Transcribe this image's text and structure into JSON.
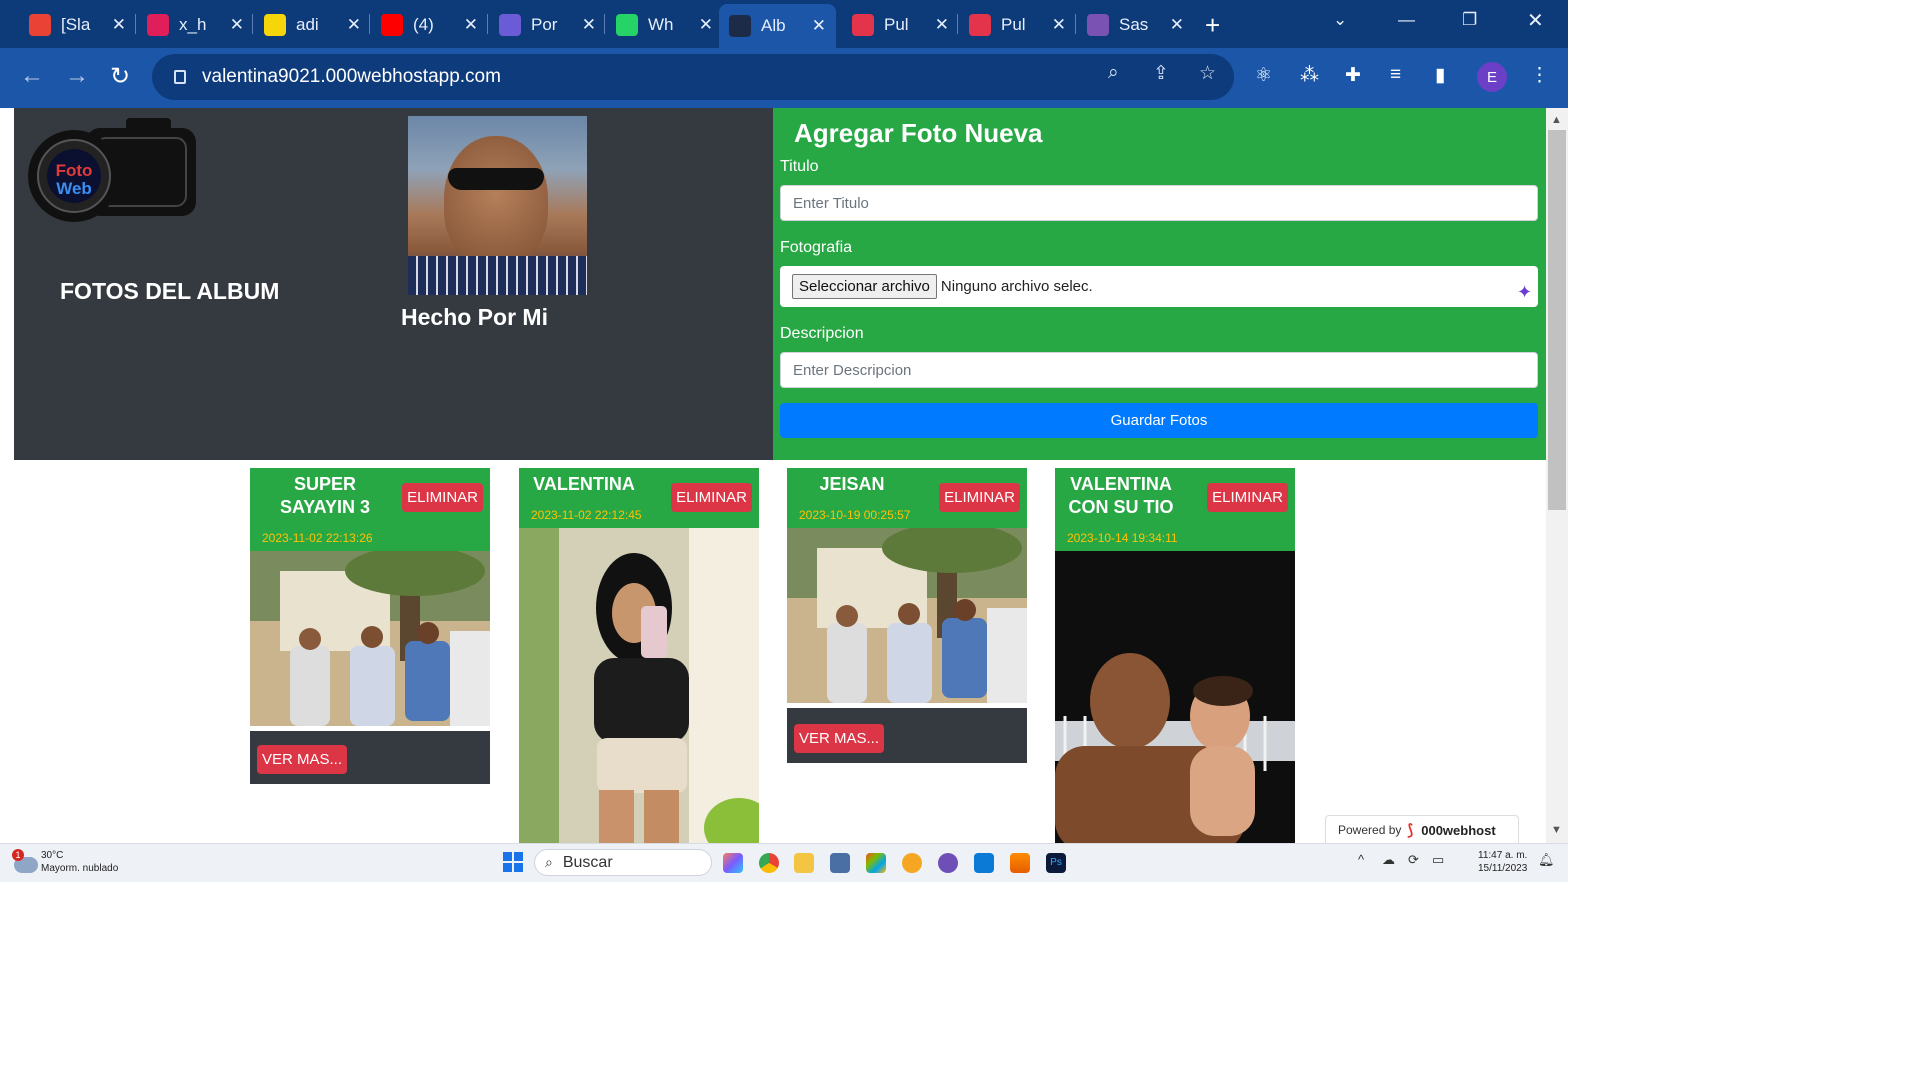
{
  "browser": {
    "tabs": [
      {
        "title": "[Sla",
        "icon": "gmail-icon",
        "color": "#ea4335"
      },
      {
        "title": "x_h",
        "icon": "slack-icon",
        "color": "#e01e5a"
      },
      {
        "title": "adi",
        "icon": "app-grid-icon",
        "color": "#f6d60b"
      },
      {
        "title": "(4)",
        "icon": "youtube-icon",
        "color": "#ff0000"
      },
      {
        "title": "Por",
        "icon": "shield-icon",
        "color": "#6b5bd6"
      },
      {
        "title": "Wh",
        "icon": "whatsapp-icon",
        "color": "#25d366"
      },
      {
        "title": "Alb",
        "icon": "camera-icon",
        "color": "#1c2b48"
      },
      {
        "title": "Pul",
        "icon": "mask-icon",
        "color": "#e4344b"
      },
      {
        "title": "Pul",
        "icon": "mask-icon",
        "color": "#e4344b"
      },
      {
        "title": "Sas",
        "icon": "bootstrap-icon",
        "color": "#7952b3"
      }
    ],
    "active_tab_index": 6,
    "new_tab_symbol": "+",
    "url": "valentina9021.000webhostapp.com",
    "profile_initial": "E"
  },
  "header": {
    "album_title": "FOTOS DEL ALBUM",
    "author_caption": "Hecho Por Mi",
    "logo_text_top": "Foto",
    "logo_text_bottom": "Web"
  },
  "form": {
    "title": "Agregar Foto Nueva",
    "title_label": "Titulo",
    "title_placeholder": "Enter Titulo",
    "photo_label": "Fotografia",
    "file_button": "Seleccionar archivo",
    "file_status": "Ninguno archivo selec.",
    "description_label": "Descripcion",
    "description_placeholder": "Enter Descripcion",
    "submit_label": "Guardar Fotos"
  },
  "cards": [
    {
      "title_line1": "SUPER",
      "title_line2": "SAYAYIN 3",
      "date": "2023-11-02 22:13:26",
      "delete_label": "ELIMINAR",
      "more_label": "VER MAS..."
    },
    {
      "title_line1": "VALENTINA",
      "title_line2": "",
      "date": "2023-11-02 22:12:45",
      "delete_label": "ELIMINAR",
      "more_label": ""
    },
    {
      "title_line1": "JEISAN",
      "title_line2": "",
      "date": "2023-10-19 00:25:57",
      "delete_label": "ELIMINAR",
      "more_label": "VER MAS..."
    },
    {
      "title_line1": "VALENTINA",
      "title_line2": "CON SU TIO",
      "date": "2023-10-14 19:34:11",
      "delete_label": "ELIMINAR",
      "more_label": ""
    }
  ],
  "powered": {
    "prefix": "Powered by",
    "brand": "000webhost"
  },
  "taskbar": {
    "weather_temp": "30°C",
    "weather_desc": "Mayorm. nublado",
    "weather_badge": "1",
    "search_placeholder": "Buscar",
    "time": "11:47 a. m.",
    "date": "15/11/2023"
  }
}
